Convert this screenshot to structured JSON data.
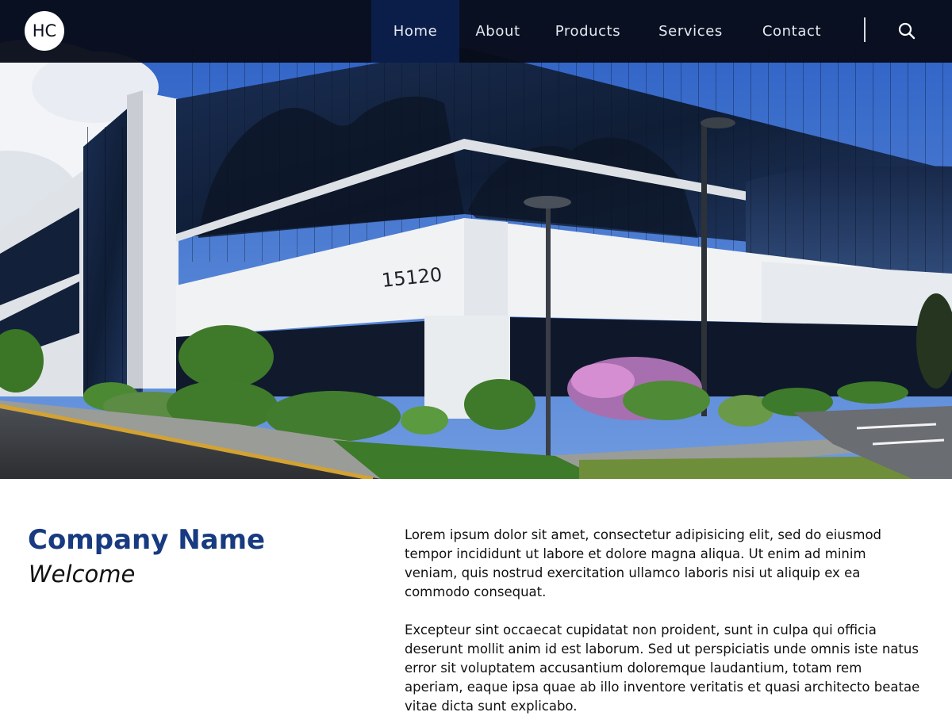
{
  "brand": {
    "logo_text": "HC"
  },
  "nav": {
    "items": [
      {
        "label": "Home",
        "active": true
      },
      {
        "label": "About",
        "active": false
      },
      {
        "label": "Products",
        "active": false
      },
      {
        "label": "Services",
        "active": false
      },
      {
        "label": "Contact",
        "active": false
      }
    ],
    "search_icon": "search-icon"
  },
  "hero": {
    "building_number": "15120"
  },
  "main": {
    "company_name": "Company Name",
    "tagline": "Welcome",
    "paragraphs": [
      "Lorem ipsum dolor sit amet, consectetur adipisicing elit, sed do eiusmod tempor incididunt ut labore et dolore magna aliqua. Ut enim ad minim veniam, quis nostrud exercitation ullamco laboris nisi ut aliquip ex ea commodo consequat.",
      "Excepteur sint occaecat cupidatat non proident, sunt in culpa qui officia deserunt mollit anim id est laborum. Sed ut perspiciatis unde omnis iste natus error sit voluptatem accusantium doloremque laudantium, totam rem aperiam, eaque ipsa quae ab illo inventore veritatis et quasi architecto beatae vitae dicta sunt explicabo."
    ]
  },
  "colors": {
    "navbar_bg": "#080d1a",
    "nav_active_bg": "#0b1e4a",
    "company_name": "#173a80",
    "body_text": "#111111"
  }
}
